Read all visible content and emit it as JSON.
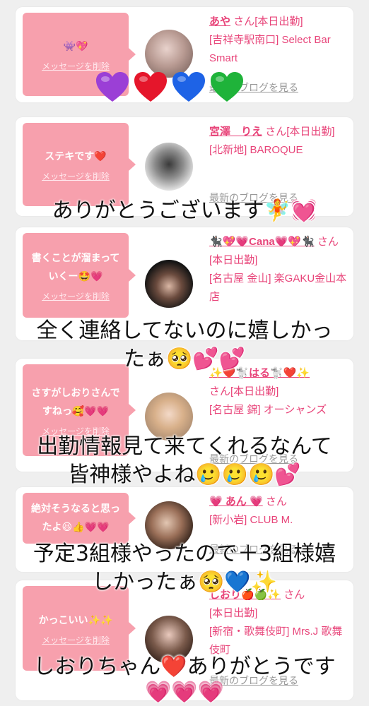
{
  "delete_label": "メッセージを削除",
  "blog_label": "最新のブログを見る",
  "cards": [
    {
      "message": "👾💖",
      "name": "あや",
      "suffix": "さん[本日出勤]",
      "location": "[吉祥寺駅南口] Select Bar Smart"
    },
    {
      "message": "ステキです❤️",
      "name": "宮澤　りえ",
      "suffix": "さん[本日出勤]",
      "location": "[北新地] BAROQUE"
    },
    {
      "message": "書くことが溜まっていくー🤩💗",
      "name": "🐈‍⬛💖💗Cana💗💖🐈‍⬛",
      "suffix": "さん[本日出勤]",
      "location": "[名古屋 金山] 楽GAKU金山本店"
    },
    {
      "message": "さすがしおりさんですねっ🥰💗💗",
      "name": "✨❤️🐩はる🐩❤️✨",
      "suffix": "さん[本日出勤]",
      "location": "[名古屋 錦] オーシャンズ"
    },
    {
      "message": "絶対そうなると思ったよ😆👍💗💗",
      "name": "💗 あん 💗",
      "suffix": "さん",
      "location": "[新小岩] CLUB M."
    },
    {
      "message": "かっこいい✨✨",
      "name": "しおり🍎🍏✨",
      "suffix": "さん",
      "location_1": "[本日出勤]",
      "location": "[新宿・歌舞伎町] Mrs.J 歌舞伎町"
    }
  ],
  "overlays": {
    "line1": "ありがとうございます🧚💓",
    "line2a": "全く連絡してないのに嬉しかっ",
    "line2b": "たぁ🥺💕💕",
    "line3a": "出勤情報見て来てくれるなんて",
    "line3b": "皆神様やよね🥲🥲🥲💕",
    "line4a": "予定3組様やったので＋3組様嬉",
    "line4b": "しかったぁ🥺💙✨",
    "line5": "しおりちゃん❤️ありがとうです",
    "line5b": "💗💗💗"
  },
  "colors": {
    "bubble": "#f7a0ad",
    "name": "#e8457a",
    "background": "#efefef",
    "heart_purple": "#9b3fd6",
    "heart_red": "#e5162b",
    "heart_blue": "#1e63e6",
    "heart_green": "#1fb33a"
  }
}
